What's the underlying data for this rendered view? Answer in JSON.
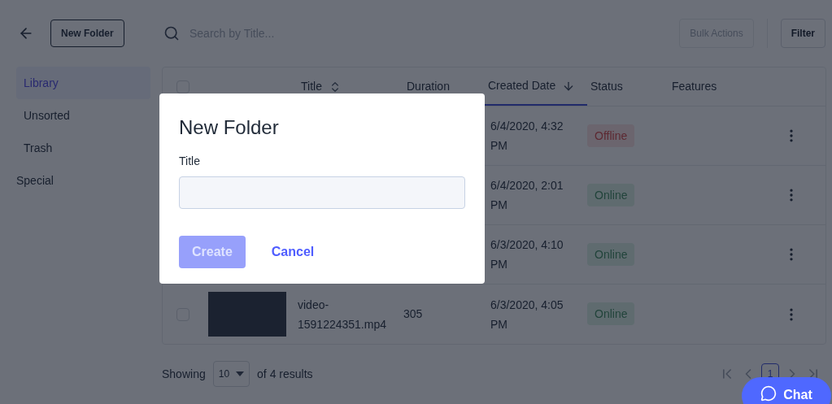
{
  "toolbar": {
    "new_folder": "New Folder",
    "search": {
      "placeholder": "Search by Title..."
    },
    "bulk_actions": {
      "label": "Bulk Actions",
      "disabled": true
    },
    "filter": {
      "label": "Filter",
      "disabled": false
    }
  },
  "sidebar": {
    "items": [
      {
        "label": "Library",
        "selected": true
      },
      {
        "label": "Unsorted",
        "selected": false
      },
      {
        "label": "Trash",
        "selected": false
      }
    ],
    "section": "Special"
  },
  "table": {
    "select_all": {
      "checked": false
    },
    "columns": [
      {
        "label": "Title",
        "kind": "sortable",
        "selected": false
      },
      {
        "label": "Duration",
        "kind": "plain",
        "selected": false
      },
      {
        "label": "Created Date",
        "kind": "descending",
        "selected": true
      },
      {
        "label": "Status",
        "kind": "plain",
        "selected": false
      },
      {
        "label": "Features",
        "kind": "plain",
        "selected": false
      }
    ],
    "rows": [
      {
        "created": [
          "6/4/2020, 4:32",
          "PM"
        ],
        "status": {
          "label": "Offline",
          "kind": "offline"
        }
      },
      {
        "created": [
          "6/4/2020, 2:01",
          "PM"
        ],
        "status": {
          "label": "Online",
          "kind": "online"
        }
      },
      {
        "created": [
          "6/3/2020, 4:10",
          "PM"
        ],
        "status": {
          "label": "Online",
          "kind": "online"
        }
      },
      {
        "checked": false,
        "title": [
          "video-",
          "1591224351.mp4"
        ],
        "duration": "305",
        "created": [
          "6/3/2020, 4:05",
          "PM"
        ],
        "status": {
          "label": "Online",
          "kind": "online"
        }
      }
    ]
  },
  "footer": {
    "showing": "Showing",
    "page_size": "10",
    "results": "of 4 results",
    "pages": [
      {
        "label": "1",
        "selected": true
      }
    ]
  },
  "dialog": {
    "title": "New Folder",
    "field_label": "Title",
    "create": {
      "label": "Create",
      "disabled": true
    },
    "cancel": "Cancel"
  },
  "chat": {
    "label": "Chat"
  }
}
